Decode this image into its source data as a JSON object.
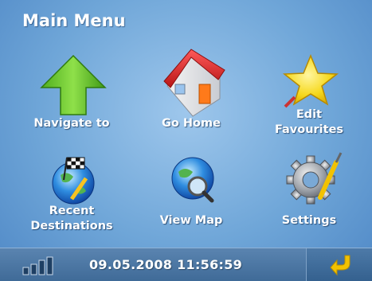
{
  "title": "Main Menu",
  "menu": {
    "navigate": "Navigate to",
    "go_home": "Go Home",
    "edit_favourites_line1": "Edit",
    "edit_favourites_line2": "Favourites",
    "recent_line1": "Recent",
    "recent_line2": "Destinations",
    "view_map": "View Map",
    "settings": "Settings"
  },
  "status": {
    "datetime": "09.05.2008 11:56:59"
  },
  "icons": {
    "navigate": "green-up-arrow-icon",
    "go_home": "house-icon",
    "edit_favourites": "star-icon",
    "recent_destinations": "globe-checkered-flag-icon",
    "view_map": "globe-magnifier-icon",
    "settings": "gear-screwdriver-icon",
    "signal": "signal-strength-icon",
    "back": "back-arrow-icon"
  },
  "colors": {
    "background": "#6fa6d8",
    "bottom_bar": "#4a76a3",
    "back_arrow": "#f2c200"
  }
}
